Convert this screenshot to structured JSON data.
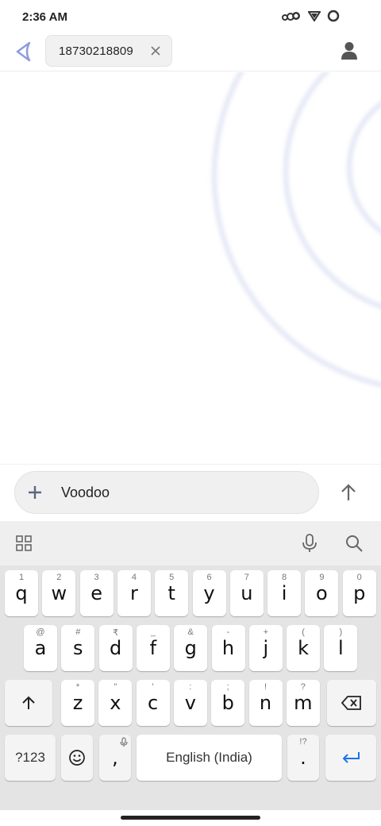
{
  "status_bar": {
    "time": "2:36 AM"
  },
  "header": {
    "recipient_number": "18730218809"
  },
  "composer": {
    "text": "Voodoo"
  },
  "keyboard": {
    "row1": [
      {
        "key": "q",
        "hint": "1"
      },
      {
        "key": "w",
        "hint": "2"
      },
      {
        "key": "e",
        "hint": "3"
      },
      {
        "key": "r",
        "hint": "4"
      },
      {
        "key": "t",
        "hint": "5"
      },
      {
        "key": "y",
        "hint": "6"
      },
      {
        "key": "u",
        "hint": "7"
      },
      {
        "key": "i",
        "hint": "8"
      },
      {
        "key": "o",
        "hint": "9"
      },
      {
        "key": "p",
        "hint": "0"
      }
    ],
    "row2": [
      {
        "key": "a",
        "hint": "@"
      },
      {
        "key": "s",
        "hint": "#"
      },
      {
        "key": "d",
        "hint": "₹"
      },
      {
        "key": "f",
        "hint": "_"
      },
      {
        "key": "g",
        "hint": "&"
      },
      {
        "key": "h",
        "hint": "-"
      },
      {
        "key": "j",
        "hint": "+"
      },
      {
        "key": "k",
        "hint": "("
      },
      {
        "key": "l",
        "hint": ")"
      }
    ],
    "row3": [
      {
        "key": "z",
        "hint": "*"
      },
      {
        "key": "x",
        "hint": "\""
      },
      {
        "key": "c",
        "hint": "'"
      },
      {
        "key": "v",
        "hint": ":"
      },
      {
        "key": "b",
        "hint": ";"
      },
      {
        "key": "n",
        "hint": "!"
      },
      {
        "key": "m",
        "hint": "?"
      }
    ],
    "symbols_label": "?123",
    "comma": ",",
    "space_label": "English (India)",
    "period": ".",
    "period_hint": "!?"
  },
  "colors": {
    "accent": "#8f9bdc",
    "enter": "#1a73e8"
  }
}
